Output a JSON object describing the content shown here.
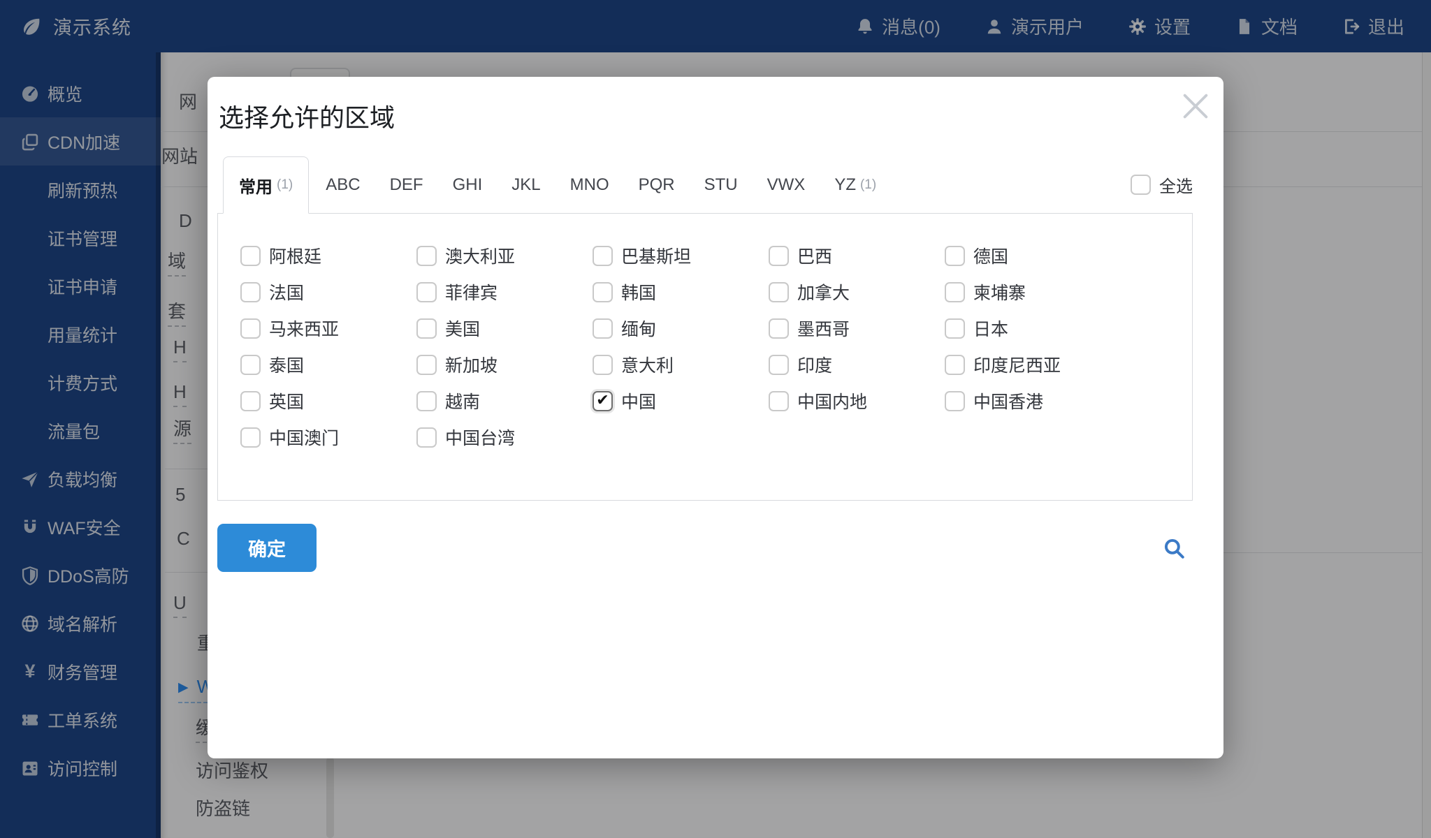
{
  "colors": {
    "navy": "#1d4586",
    "primary_button": "#2d8bd8",
    "link_blue": "#2d8cf0",
    "search_icon_blue": "#3b7ac6"
  },
  "topbar": {
    "brand": "演示系统",
    "menu": [
      {
        "key": "messages",
        "icon": "bell",
        "label": "消息(0)"
      },
      {
        "key": "user",
        "icon": "user",
        "label": "演示用户"
      },
      {
        "key": "settings",
        "icon": "gear",
        "label": "设置"
      },
      {
        "key": "docs",
        "icon": "doc",
        "label": "文档"
      },
      {
        "key": "logout",
        "icon": "logout",
        "label": "退出"
      }
    ]
  },
  "sidebar": {
    "items": [
      {
        "key": "overview",
        "icon": "gauge",
        "label": "概览"
      },
      {
        "key": "cdn",
        "icon": "copy",
        "label": "CDN加速",
        "active": true
      },
      {
        "key": "refresh-preheat",
        "label": "刷新预热"
      },
      {
        "key": "cert-manage",
        "label": "证书管理"
      },
      {
        "key": "cert-apply",
        "label": "证书申请"
      },
      {
        "key": "usage-stats",
        "label": "用量统计"
      },
      {
        "key": "billing",
        "label": "计费方式"
      },
      {
        "key": "traffic-pack",
        "label": "流量包"
      },
      {
        "key": "load-balance",
        "icon": "plane",
        "label": "负载均衡"
      },
      {
        "key": "waf",
        "icon": "magnet",
        "label": "WAF安全"
      },
      {
        "key": "ddos",
        "icon": "shield",
        "label": "DDoS高防"
      },
      {
        "key": "dns",
        "icon": "globe",
        "label": "域名解析"
      },
      {
        "key": "finance",
        "icon": "yen",
        "label": "财务管理"
      },
      {
        "key": "tickets",
        "icon": "ticket",
        "label": "工单系统"
      },
      {
        "key": "access-control",
        "icon": "idcard",
        "label": "访问控制"
      }
    ]
  },
  "background": {
    "fragments": [
      {
        "text": "网"
      },
      {
        "text": "网站"
      },
      {
        "text": "D"
      },
      {
        "text": "域",
        "underline": true
      },
      {
        "text": "套",
        "underline": true
      },
      {
        "text": "H",
        "underline": true
      },
      {
        "text": "H",
        "underline": true
      },
      {
        "text": "源",
        "underline": true
      },
      {
        "text": "5"
      },
      {
        "text": "C"
      },
      {
        "text": "U",
        "underline": true
      },
      {
        "text": "重"
      },
      {
        "text": "W",
        "underline": true,
        "accent": true,
        "arrow": "▶"
      },
      {
        "text": "缓",
        "underline": true
      },
      {
        "text": "访问鉴权"
      },
      {
        "text": "防盗链"
      }
    ]
  },
  "modal": {
    "title": "选择允许的区域",
    "tabs": [
      {
        "label": "常用",
        "count": "(1)",
        "active": true
      },
      {
        "label": "ABC"
      },
      {
        "label": "DEF"
      },
      {
        "label": "GHI"
      },
      {
        "label": "JKL"
      },
      {
        "label": "MNO"
      },
      {
        "label": "PQR"
      },
      {
        "label": "STU"
      },
      {
        "label": "VWX"
      },
      {
        "label": "YZ",
        "count": "(1)"
      }
    ],
    "select_all_label": "全选",
    "regions": [
      {
        "label": "阿根廷",
        "checked": false
      },
      {
        "label": "澳大利亚",
        "checked": false
      },
      {
        "label": "巴基斯坦",
        "checked": false
      },
      {
        "label": "巴西",
        "checked": false
      },
      {
        "label": "德国",
        "checked": false
      },
      {
        "label": "法国",
        "checked": false
      },
      {
        "label": "菲律宾",
        "checked": false
      },
      {
        "label": "韩国",
        "checked": false
      },
      {
        "label": "加拿大",
        "checked": false
      },
      {
        "label": "柬埔寨",
        "checked": false
      },
      {
        "label": "马来西亚",
        "checked": false
      },
      {
        "label": "美国",
        "checked": false
      },
      {
        "label": "缅甸",
        "checked": false
      },
      {
        "label": "墨西哥",
        "checked": false
      },
      {
        "label": "日本",
        "checked": false
      },
      {
        "label": "泰国",
        "checked": false
      },
      {
        "label": "新加坡",
        "checked": false
      },
      {
        "label": "意大利",
        "checked": false
      },
      {
        "label": "印度",
        "checked": false
      },
      {
        "label": "印度尼西亚",
        "checked": false
      },
      {
        "label": "英国",
        "checked": false
      },
      {
        "label": "越南",
        "checked": false
      },
      {
        "label": "中国",
        "checked": true
      },
      {
        "label": "中国内地",
        "checked": false
      },
      {
        "label": "中国香港",
        "checked": false
      },
      {
        "label": "中国澳门",
        "checked": false
      },
      {
        "label": "中国台湾",
        "checked": false
      }
    ],
    "confirm_label": "确定"
  }
}
